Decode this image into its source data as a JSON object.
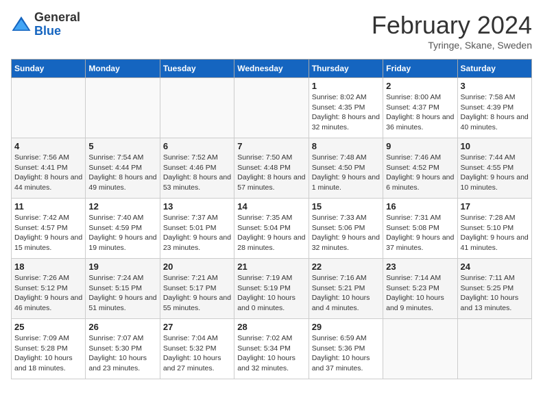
{
  "logo": {
    "general": "General",
    "blue": "Blue"
  },
  "title": "February 2024",
  "subtitle": "Tyringe, Skane, Sweden",
  "weekdays": [
    "Sunday",
    "Monday",
    "Tuesday",
    "Wednesday",
    "Thursday",
    "Friday",
    "Saturday"
  ],
  "weeks": [
    [
      {
        "day": "",
        "info": ""
      },
      {
        "day": "",
        "info": ""
      },
      {
        "day": "",
        "info": ""
      },
      {
        "day": "",
        "info": ""
      },
      {
        "day": "1",
        "sunrise": "8:02 AM",
        "sunset": "4:35 PM",
        "daylight": "8 hours and 32 minutes."
      },
      {
        "day": "2",
        "sunrise": "8:00 AM",
        "sunset": "4:37 PM",
        "daylight": "8 hours and 36 minutes."
      },
      {
        "day": "3",
        "sunrise": "7:58 AM",
        "sunset": "4:39 PM",
        "daylight": "8 hours and 40 minutes."
      }
    ],
    [
      {
        "day": "4",
        "sunrise": "7:56 AM",
        "sunset": "4:41 PM",
        "daylight": "8 hours and 44 minutes."
      },
      {
        "day": "5",
        "sunrise": "7:54 AM",
        "sunset": "4:44 PM",
        "daylight": "8 hours and 49 minutes."
      },
      {
        "day": "6",
        "sunrise": "7:52 AM",
        "sunset": "4:46 PM",
        "daylight": "8 hours and 53 minutes."
      },
      {
        "day": "7",
        "sunrise": "7:50 AM",
        "sunset": "4:48 PM",
        "daylight": "8 hours and 57 minutes."
      },
      {
        "day": "8",
        "sunrise": "7:48 AM",
        "sunset": "4:50 PM",
        "daylight": "9 hours and 1 minute."
      },
      {
        "day": "9",
        "sunrise": "7:46 AM",
        "sunset": "4:52 PM",
        "daylight": "9 hours and 6 minutes."
      },
      {
        "day": "10",
        "sunrise": "7:44 AM",
        "sunset": "4:55 PM",
        "daylight": "9 hours and 10 minutes."
      }
    ],
    [
      {
        "day": "11",
        "sunrise": "7:42 AM",
        "sunset": "4:57 PM",
        "daylight": "9 hours and 15 minutes."
      },
      {
        "day": "12",
        "sunrise": "7:40 AM",
        "sunset": "4:59 PM",
        "daylight": "9 hours and 19 minutes."
      },
      {
        "day": "13",
        "sunrise": "7:37 AM",
        "sunset": "5:01 PM",
        "daylight": "9 hours and 23 minutes."
      },
      {
        "day": "14",
        "sunrise": "7:35 AM",
        "sunset": "5:04 PM",
        "daylight": "9 hours and 28 minutes."
      },
      {
        "day": "15",
        "sunrise": "7:33 AM",
        "sunset": "5:06 PM",
        "daylight": "9 hours and 32 minutes."
      },
      {
        "day": "16",
        "sunrise": "7:31 AM",
        "sunset": "5:08 PM",
        "daylight": "9 hours and 37 minutes."
      },
      {
        "day": "17",
        "sunrise": "7:28 AM",
        "sunset": "5:10 PM",
        "daylight": "9 hours and 41 minutes."
      }
    ],
    [
      {
        "day": "18",
        "sunrise": "7:26 AM",
        "sunset": "5:12 PM",
        "daylight": "9 hours and 46 minutes."
      },
      {
        "day": "19",
        "sunrise": "7:24 AM",
        "sunset": "5:15 PM",
        "daylight": "9 hours and 51 minutes."
      },
      {
        "day": "20",
        "sunrise": "7:21 AM",
        "sunset": "5:17 PM",
        "daylight": "9 hours and 55 minutes."
      },
      {
        "day": "21",
        "sunrise": "7:19 AM",
        "sunset": "5:19 PM",
        "daylight": "10 hours and 0 minutes."
      },
      {
        "day": "22",
        "sunrise": "7:16 AM",
        "sunset": "5:21 PM",
        "daylight": "10 hours and 4 minutes."
      },
      {
        "day": "23",
        "sunrise": "7:14 AM",
        "sunset": "5:23 PM",
        "daylight": "10 hours and 9 minutes."
      },
      {
        "day": "24",
        "sunrise": "7:11 AM",
        "sunset": "5:25 PM",
        "daylight": "10 hours and 13 minutes."
      }
    ],
    [
      {
        "day": "25",
        "sunrise": "7:09 AM",
        "sunset": "5:28 PM",
        "daylight": "10 hours and 18 minutes."
      },
      {
        "day": "26",
        "sunrise": "7:07 AM",
        "sunset": "5:30 PM",
        "daylight": "10 hours and 23 minutes."
      },
      {
        "day": "27",
        "sunrise": "7:04 AM",
        "sunset": "5:32 PM",
        "daylight": "10 hours and 27 minutes."
      },
      {
        "day": "28",
        "sunrise": "7:02 AM",
        "sunset": "5:34 PM",
        "daylight": "10 hours and 32 minutes."
      },
      {
        "day": "29",
        "sunrise": "6:59 AM",
        "sunset": "5:36 PM",
        "daylight": "10 hours and 37 minutes."
      },
      {
        "day": "",
        "info": ""
      },
      {
        "day": "",
        "info": ""
      }
    ]
  ]
}
